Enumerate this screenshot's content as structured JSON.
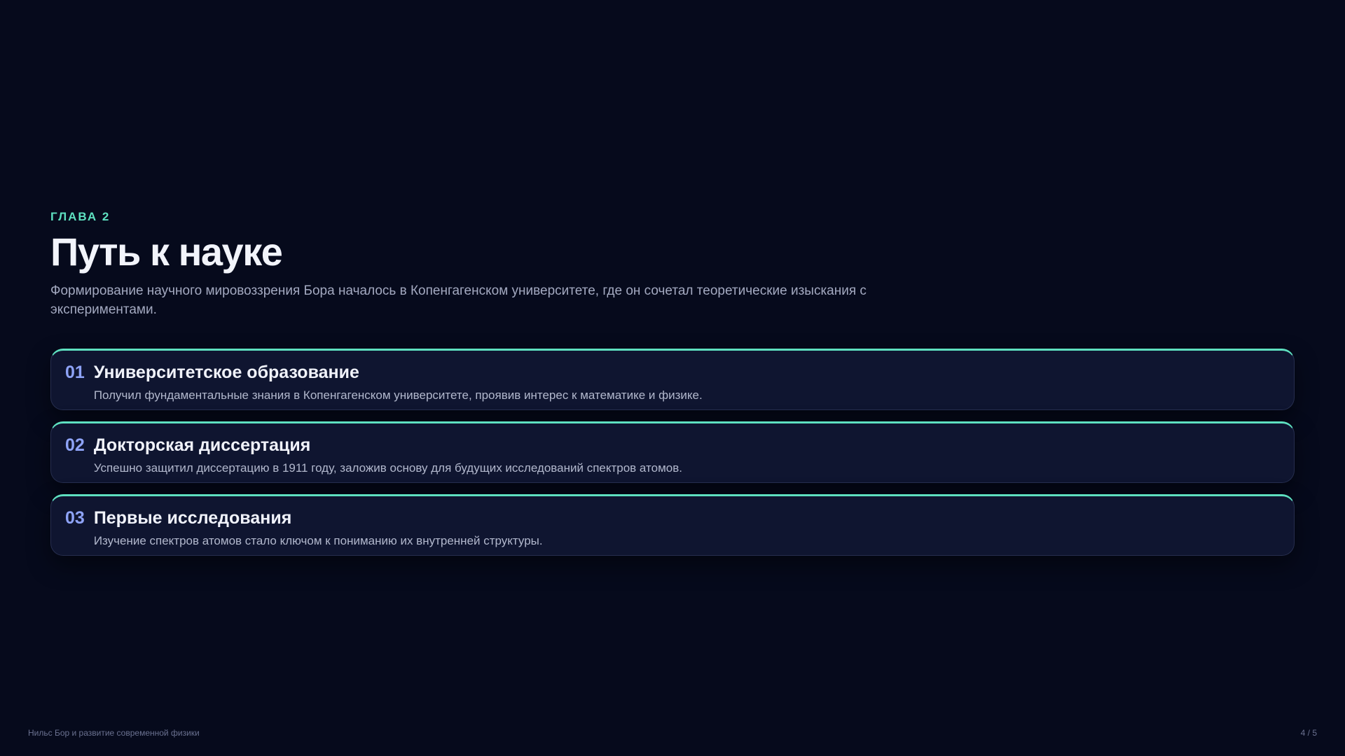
{
  "slide": {
    "chapter": "ГЛАВА 2",
    "title": "Путь к науке",
    "subtitle": "Формирование научного мировоззрения Бора началось в Копенгагенском университете, где он сочетал теоретические изыскания с экспериментами."
  },
  "cards": [
    {
      "num": "01",
      "title": "Университетское образование",
      "desc": "Получил фундаментальные знания в Копенгагенском университете, проявив интерес к математике и физике."
    },
    {
      "num": "02",
      "title": "Докторская диссертация",
      "desc": "Успешно защитил диссертацию в 1911 году, заложив основу для будущих исследований спектров атомов."
    },
    {
      "num": "03",
      "title": "Первые исследования",
      "desc": "Изучение спектров атомов стало ключом к пониманию их внутренней структуры."
    }
  ],
  "footer": {
    "presentation_title": "Нильс Бор и развитие современной физики",
    "page_indicator": "4 / 5"
  },
  "colors": {
    "background": "#060a1c",
    "accent_teal": "#5ee0c0",
    "accent_number": "#8ea3f7",
    "card_background": "#0f1530"
  }
}
